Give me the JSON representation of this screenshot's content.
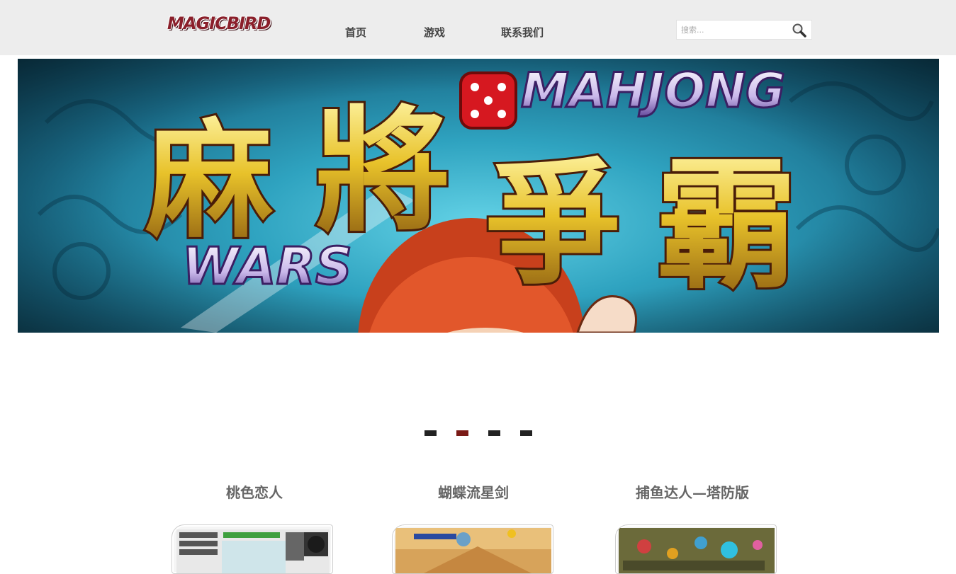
{
  "header": {
    "logo_text": "MAGICBIRD",
    "nav": [
      {
        "label": "首页"
      },
      {
        "label": "游戏"
      },
      {
        "label": "联系我们"
      }
    ],
    "search": {
      "placeholder": "搜索..."
    }
  },
  "banner": {
    "title_cn": "麻將爭霸",
    "title_en_top": "MAHJONG",
    "title_en_bottom": "WARS"
  },
  "slider": {
    "count": 4,
    "active_index": 1
  },
  "games": [
    {
      "title": "桃色恋人"
    },
    {
      "title": "蝴蝶流星剑"
    },
    {
      "title": "捕鱼达人—塔防版"
    }
  ],
  "colors": {
    "header_bg": "#ededed",
    "dot": "#222222",
    "dot_active": "#7a1a16",
    "title_text": "#666666",
    "nav_text": "#444444"
  },
  "icons": {
    "search": "magnifier-icon",
    "dice": "dice-icon"
  }
}
